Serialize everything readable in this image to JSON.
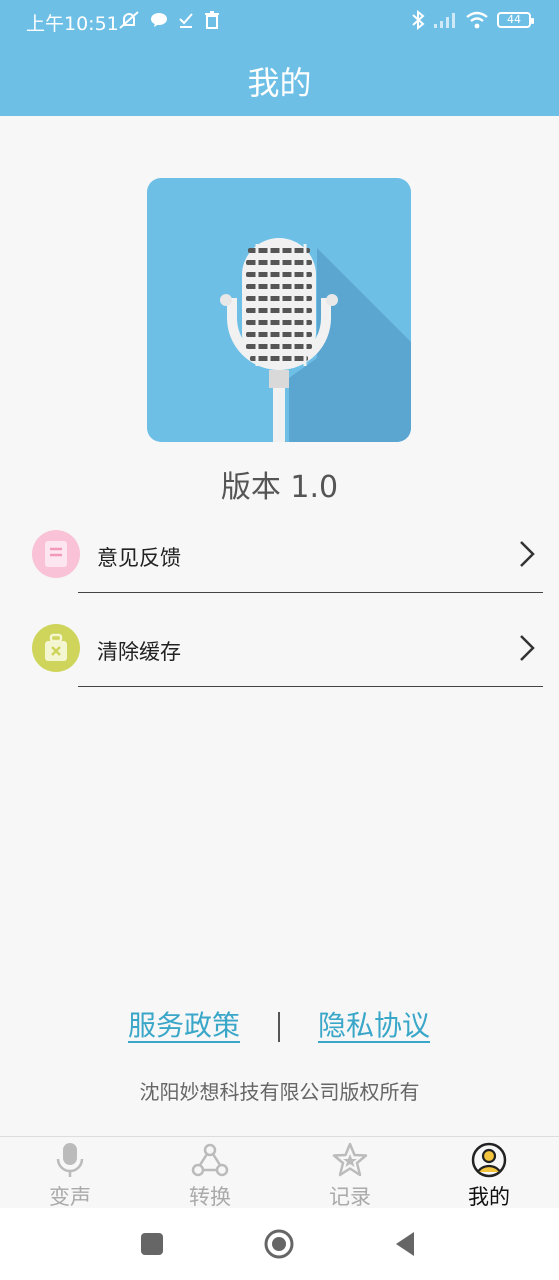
{
  "status": {
    "time": "上午10:51",
    "battery": "44"
  },
  "header": {
    "title": "我的"
  },
  "app": {
    "version": "版本 1.0"
  },
  "menu": [
    {
      "label": "意见反馈",
      "icon": "feedback-note-icon",
      "color": "#f9b6cf"
    },
    {
      "label": "清除缓存",
      "icon": "luggage-clean-icon",
      "color": "#cfd45a"
    }
  ],
  "footer": {
    "service_policy": "服务政策",
    "privacy_policy": "隐私协议",
    "copyright": "沈阳妙想科技有限公司版权所有"
  },
  "tabs": [
    {
      "label": "变声",
      "icon": "microphone-icon",
      "active": false
    },
    {
      "label": "转换",
      "icon": "share-nodes-icon",
      "active": false
    },
    {
      "label": "记录",
      "icon": "star-icon",
      "active": false
    },
    {
      "label": "我的",
      "icon": "user-profile-icon",
      "active": true
    }
  ],
  "colors": {
    "header": "#6ebfe6",
    "link": "#3aa7c9",
    "logo_bg": "#6ebfe6"
  }
}
